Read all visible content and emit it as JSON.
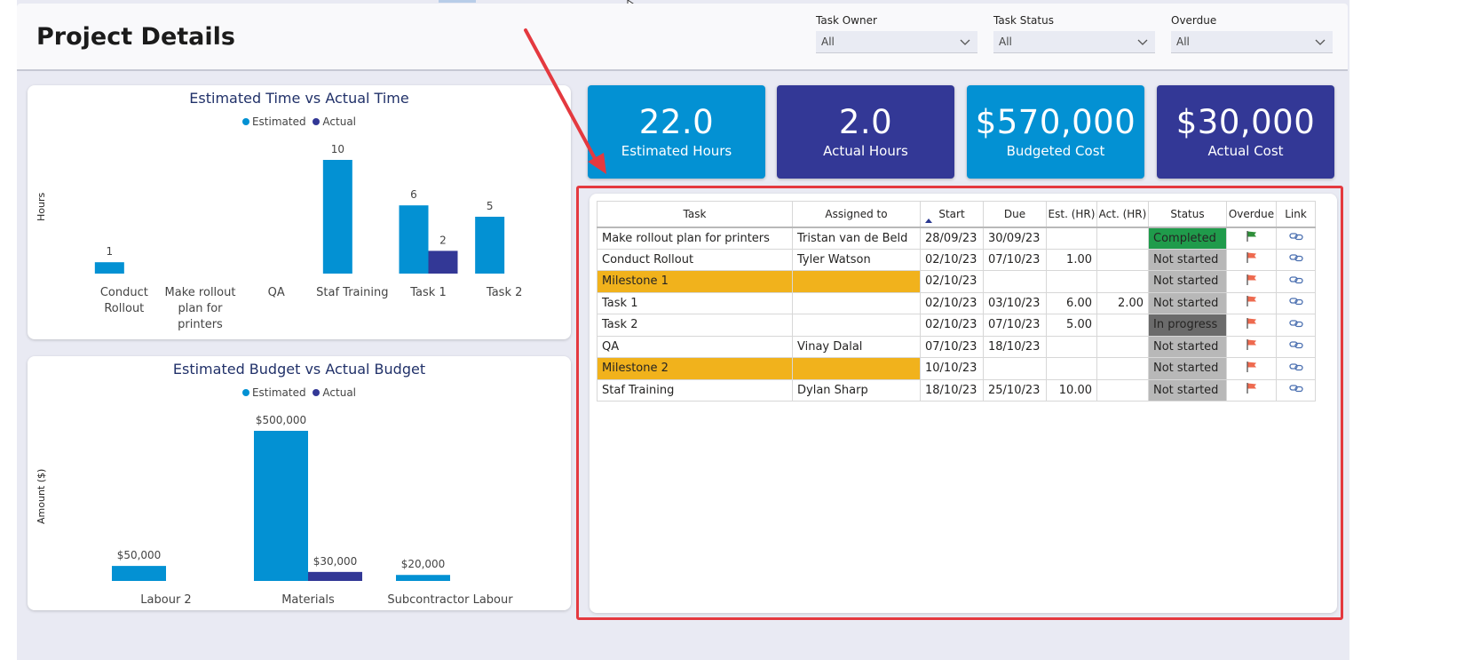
{
  "page": {
    "title": "Project Details"
  },
  "slicers": [
    {
      "label": "Task Owner",
      "value": "All"
    },
    {
      "label": "Task Status",
      "value": "All"
    },
    {
      "label": "Overdue",
      "value": "All"
    }
  ],
  "kpis": [
    {
      "value": "22.0",
      "label": "Estimated Hours",
      "color": "#0391d3"
    },
    {
      "value": "2.0",
      "label": "Actual Hours",
      "color": "#333896"
    },
    {
      "value": "$570,000",
      "label": "Budgeted Cost",
      "color": "#0391d3"
    },
    {
      "value": "$30,000",
      "label": "Actual Cost",
      "color": "#333896"
    }
  ],
  "colors": {
    "estimated": "#0391d3",
    "actual": "#333896",
    "milestone": "#f1b21c",
    "completed": "#1f9b4b",
    "not_started": "#b8b8b8",
    "in_progress": "#6b6b6b",
    "highlight": "#e4393f"
  },
  "chart_data": [
    {
      "type": "bar",
      "title": "Estimated Time vs Actual Time",
      "ylabel": "Hours",
      "legend": [
        "Estimated",
        "Actual"
      ],
      "legend_position": "top-center",
      "categories": [
        "Conduct Rollout",
        "Make rollout plan for printers",
        "QA",
        "Staf Training",
        "Task 1",
        "Task 2"
      ],
      "series": [
        {
          "name": "Estimated",
          "values": [
            1,
            null,
            null,
            10,
            6,
            5
          ],
          "labels": [
            "1",
            "",
            "",
            "10",
            "6",
            "5"
          ]
        },
        {
          "name": "Actual",
          "values": [
            null,
            null,
            null,
            null,
            2,
            null
          ],
          "labels": [
            "",
            "",
            "",
            "",
            "2",
            ""
          ]
        }
      ],
      "ylim": [
        0,
        10
      ],
      "grid": false
    },
    {
      "type": "bar",
      "title": "Estimated Budget vs Actual Budget",
      "ylabel": "Amount ($)",
      "legend": [
        "Estimated",
        "Actual"
      ],
      "legend_position": "top-center",
      "categories": [
        "Labour 2",
        "Materials",
        "Subcontractor Labour"
      ],
      "series": [
        {
          "name": "Estimated",
          "values": [
            50000,
            500000,
            20000
          ],
          "labels": [
            "$50,000",
            "$500,000",
            "$20,000"
          ]
        },
        {
          "name": "Actual",
          "values": [
            null,
            30000,
            null
          ],
          "labels": [
            "",
            "$30,000",
            ""
          ]
        }
      ],
      "ylim": [
        0,
        500000
      ],
      "grid": false
    }
  ],
  "table": {
    "columns": [
      "Task",
      "Assigned to",
      "Start",
      "Due",
      "Est. (HR)",
      "Act. (HR)",
      "Status",
      "Overdue",
      "Link"
    ],
    "sorted_column": "Start",
    "rows": [
      {
        "task": "Make rollout plan for printers",
        "assigned": "Tristan van de Beld",
        "start": "28/09/23",
        "due": "30/09/23",
        "est": "",
        "act": "",
        "status": "Completed",
        "status_kind": "completed",
        "overdue": "green-flag-icon",
        "milestone": false
      },
      {
        "task": "Conduct Rollout",
        "assigned": "Tyler Watson",
        "start": "02/10/23",
        "due": "07/10/23",
        "est": "1.00",
        "act": "",
        "status": "Not started",
        "status_kind": "not",
        "overdue": "red-flag-icon",
        "milestone": false
      },
      {
        "task": "Milestone 1",
        "assigned": "",
        "start": "02/10/23",
        "due": "",
        "est": "",
        "act": "",
        "status": "Not started",
        "status_kind": "not",
        "overdue": "red-flag-icon",
        "milestone": true
      },
      {
        "task": "Task 1",
        "assigned": "",
        "start": "02/10/23",
        "due": "03/10/23",
        "est": "6.00",
        "act": "2.00",
        "status": "Not started",
        "status_kind": "not",
        "overdue": "red-flag-icon",
        "milestone": false
      },
      {
        "task": "Task 2",
        "assigned": "",
        "start": "02/10/23",
        "due": "07/10/23",
        "est": "5.00",
        "act": "",
        "status": "In progress",
        "status_kind": "prog",
        "overdue": "red-flag-icon",
        "milestone": false
      },
      {
        "task": "QA",
        "assigned": "Vinay Dalal",
        "start": "07/10/23",
        "due": "18/10/23",
        "est": "",
        "act": "",
        "status": "Not started",
        "status_kind": "not",
        "overdue": "red-flag-icon",
        "milestone": false
      },
      {
        "task": "Milestone 2",
        "assigned": "",
        "start": "10/10/23",
        "due": "",
        "est": "",
        "act": "",
        "status": "Not started",
        "status_kind": "not",
        "overdue": "red-flag-icon",
        "milestone": true
      },
      {
        "task": "Staf Training",
        "assigned": "Dylan Sharp",
        "start": "18/10/23",
        "due": "25/10/23",
        "est": "10.00",
        "act": "",
        "status": "Not started",
        "status_kind": "not",
        "overdue": "red-flag-icon",
        "milestone": false
      }
    ]
  }
}
